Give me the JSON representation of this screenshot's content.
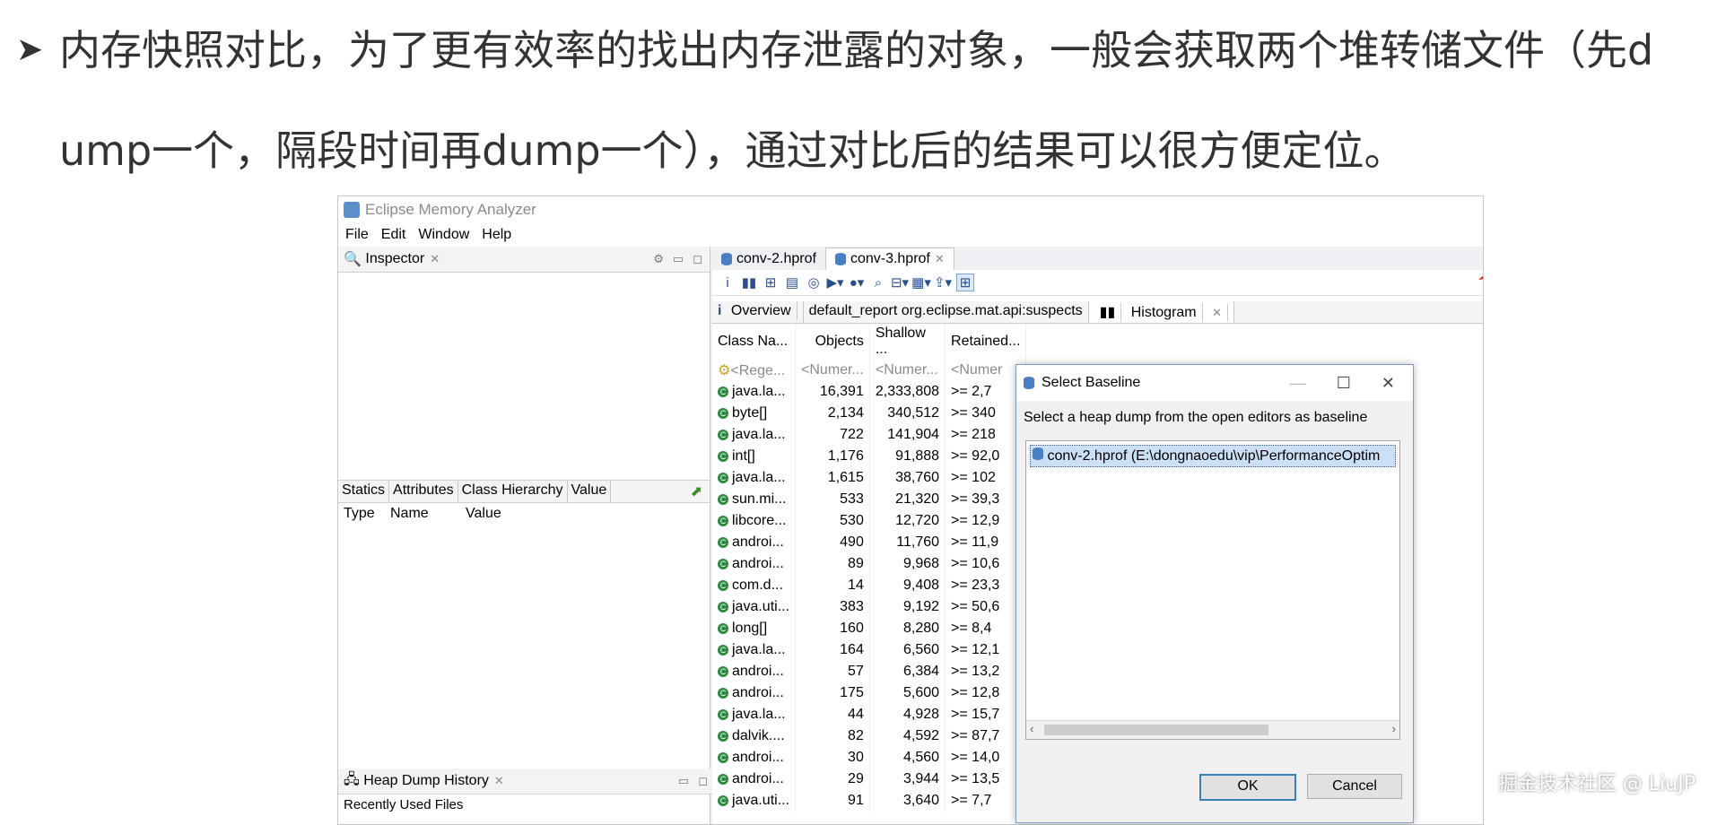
{
  "slide": {
    "bullet": "➤",
    "line1": "内存快照对比，为了更有效率的找出内存泄露的对象，一般会获取两个堆转储文件（先d",
    "line2": "ump一个，隔段时间再dump一个），通过对比后的结果可以很方便定位。"
  },
  "window": {
    "title": "Eclipse Memory Analyzer",
    "menu": [
      "File",
      "Edit",
      "Window",
      "Help"
    ]
  },
  "inspector": {
    "tab_label": "Inspector",
    "subtabs": [
      "Statics",
      "Attributes",
      "Class Hierarchy",
      "Value"
    ],
    "columns": [
      "Type",
      "Name",
      "Value"
    ]
  },
  "heap_history": {
    "tab_label": "Heap Dump History",
    "recent_label": "Recently Used Files"
  },
  "editor": {
    "tabs": [
      "conv-2.hprof",
      "conv-3.hprof"
    ],
    "subtabs": [
      "Overview",
      "default_report  org.eclipse.mat.api:suspects",
      "Histogram"
    ],
    "columns": [
      "Class Na...",
      "Objects",
      "Shallow ...",
      "Retained..."
    ],
    "filter_row": [
      "<Rege...",
      "<Numer...",
      "<Numer...",
      "<Numer"
    ],
    "rows": [
      [
        "java.la...",
        "16,391",
        "2,333,808",
        ">= 2,7"
      ],
      [
        "byte[]",
        "2,134",
        "340,512",
        ">= 340"
      ],
      [
        "java.la...",
        "722",
        "141,904",
        ">= 218"
      ],
      [
        "int[]",
        "1,176",
        "91,888",
        ">= 92,0"
      ],
      [
        "java.la...",
        "1,615",
        "38,760",
        ">= 102"
      ],
      [
        "sun.mi...",
        "533",
        "21,320",
        ">= 39,3"
      ],
      [
        "libcore...",
        "530",
        "12,720",
        ">= 12,9"
      ],
      [
        "androi...",
        "490",
        "11,760",
        ">= 11,9"
      ],
      [
        "androi...",
        "89",
        "9,968",
        ">= 10,6"
      ],
      [
        "com.d...",
        "14",
        "9,408",
        ">= 23,3"
      ],
      [
        "java.uti...",
        "383",
        "9,192",
        ">= 50,6"
      ],
      [
        "long[]",
        "160",
        "8,280",
        ">= 8,4"
      ],
      [
        "java.la...",
        "164",
        "6,560",
        ">= 12,1"
      ],
      [
        "androi...",
        "57",
        "6,384",
        ">= 13,2"
      ],
      [
        "androi...",
        "175",
        "5,600",
        ">= 12,8"
      ],
      [
        "java.la...",
        "44",
        "4,928",
        ">= 15,7"
      ],
      [
        "dalvik....",
        "82",
        "4,592",
        ">= 87,7"
      ],
      [
        "androi...",
        "30",
        "4,560",
        ">= 14,0"
      ],
      [
        "androi...",
        "29",
        "3,944",
        ">= 13,5"
      ],
      [
        "java.uti...",
        "91",
        "3,640",
        ">= 7,7"
      ]
    ]
  },
  "dialog": {
    "title": "Select Baseline",
    "prompt": "Select a heap dump from the open editors as baseline",
    "item": "conv-2.hprof (E:\\dongnaoedu\\vip\\PerformanceOptim",
    "ok": "OK",
    "cancel": "Cancel"
  },
  "watermark": "掘金技术社区 @ LiuJP",
  "colors": {
    "arrow": "#e02020",
    "class_icon": "#2d8a3e",
    "db_icon": "#4a7fc2"
  }
}
